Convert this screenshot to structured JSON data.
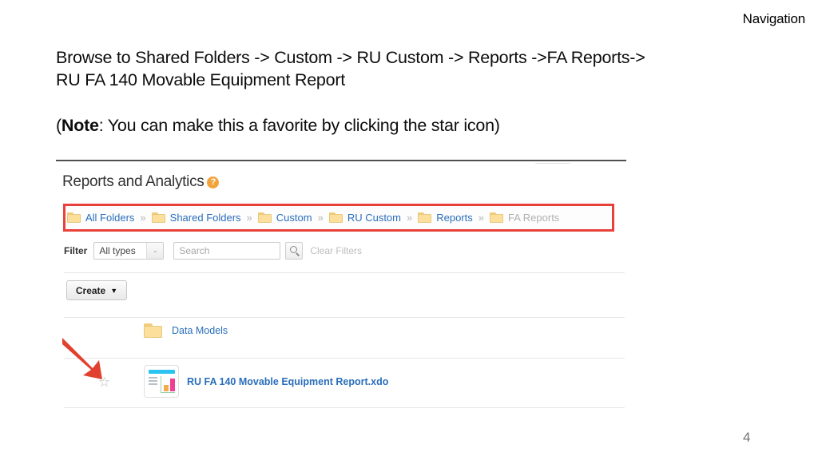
{
  "slide": {
    "nav_label": "Navigation",
    "instruction_line1": "Browse to Shared Folders -> Custom -> RU Custom -> Reports ->FA Reports->",
    "instruction_line2": "RU FA 140 Movable Equipment Report",
    "note_open": "(",
    "note_bold": "Note",
    "note_rest": ": You can make this a favorite by clicking the star icon)",
    "page_number": "4"
  },
  "app": {
    "title": "Reports and Analytics",
    "help_icon_glyph": "?",
    "breadcrumb": [
      {
        "label": "All Folders",
        "current": false
      },
      {
        "label": "Shared Folders",
        "current": false
      },
      {
        "label": "Custom",
        "current": false
      },
      {
        "label": "RU Custom",
        "current": false
      },
      {
        "label": "Reports",
        "current": false
      },
      {
        "label": "FA Reports",
        "current": true
      }
    ],
    "breadcrumb_separator": "»",
    "toolbar": {
      "filter_label": "Filter",
      "filter_value": "All types",
      "filter_caret": "⌄",
      "search_placeholder": "Search",
      "search_value": "",
      "search_button_icon": "search-icon",
      "clear_filters_label": "Clear Filters"
    },
    "create": {
      "label": "Create",
      "caret": "▼"
    },
    "rows": [
      {
        "type": "folder",
        "name": "Data Models",
        "starred": false,
        "star_glyph": ""
      },
      {
        "type": "report",
        "name": "RU FA 140 Movable Equipment Report.xdo",
        "starred": false,
        "star_glyph": "☆"
      }
    ]
  },
  "colors": {
    "highlight_red": "#e8413a",
    "arrow_red": "#e2402f",
    "link_blue": "#2a6ebb",
    "folder_yellow": "#fbdf9a",
    "help_orange": "#f2a33c",
    "report_icon_cyan": "#29c4ef",
    "report_icon_orange": "#f6ab4a",
    "report_icon_pink": "#ee3f90"
  }
}
